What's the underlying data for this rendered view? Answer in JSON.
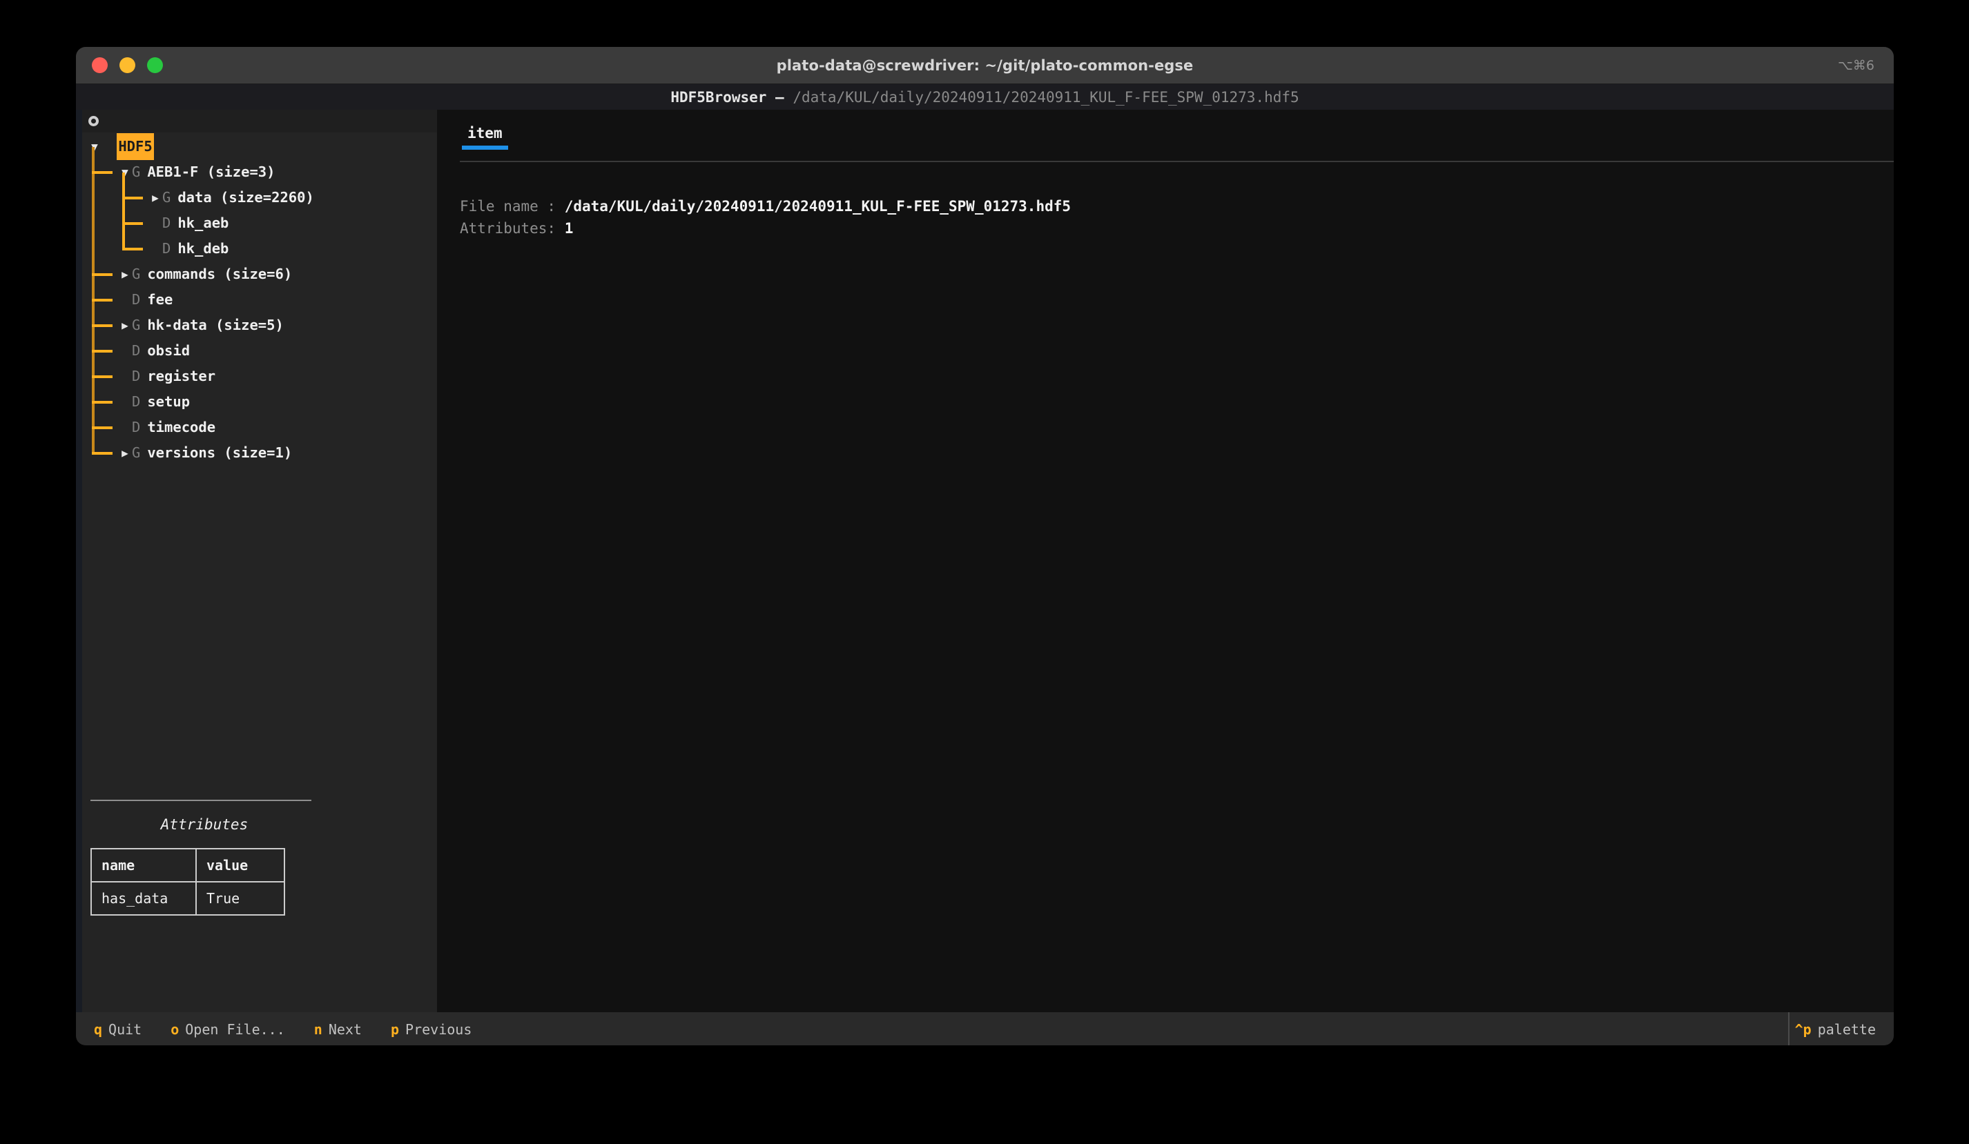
{
  "window": {
    "title": "plato-data@screwdriver: ~/git/plato-common-egse",
    "shortcut": "⌥⌘6",
    "traffic_lights": [
      "close",
      "minimize",
      "zoom"
    ]
  },
  "app_header": {
    "name": "HDF5Browser",
    "separator": "—",
    "path": "/data/KUL/daily/20240911/20240911_KUL_F-FEE_SPW_01273.hdf5"
  },
  "tree_pane": {
    "toolbar_icon": "loading-ring-icon",
    "nodes": [
      {
        "depth": 0,
        "caret": "▼",
        "kind": "",
        "label": "HDF5",
        "selected": true
      },
      {
        "depth": 1,
        "caret": "▼",
        "kind": "G",
        "label": "AEB1-F (size=3)",
        "selected": false
      },
      {
        "depth": 2,
        "caret": "▶",
        "kind": "G",
        "label": "data (size=2260)",
        "selected": false
      },
      {
        "depth": 2,
        "caret": "",
        "kind": "D",
        "label": "hk_aeb",
        "selected": false
      },
      {
        "depth": 2,
        "caret": "",
        "kind": "D",
        "label": "hk_deb",
        "selected": false
      },
      {
        "depth": 1,
        "caret": "▶",
        "kind": "G",
        "label": "commands (size=6)",
        "selected": false
      },
      {
        "depth": 1,
        "caret": "",
        "kind": "D",
        "label": "fee",
        "selected": false
      },
      {
        "depth": 1,
        "caret": "▶",
        "kind": "G",
        "label": "hk-data (size=5)",
        "selected": false
      },
      {
        "depth": 1,
        "caret": "",
        "kind": "D",
        "label": "obsid",
        "selected": false
      },
      {
        "depth": 1,
        "caret": "",
        "kind": "D",
        "label": "register",
        "selected": false
      },
      {
        "depth": 1,
        "caret": "",
        "kind": "D",
        "label": "setup",
        "selected": false
      },
      {
        "depth": 1,
        "caret": "",
        "kind": "D",
        "label": "timecode",
        "selected": false
      },
      {
        "depth": 1,
        "caret": "▶",
        "kind": "G",
        "label": "versions (size=1)",
        "selected": false
      }
    ]
  },
  "attributes_panel": {
    "title": "Attributes",
    "columns": [
      "name",
      "value"
    ],
    "rows": [
      [
        "has_data",
        "True"
      ]
    ]
  },
  "content": {
    "tabs": [
      {
        "label": "item",
        "active": true
      }
    ],
    "details": [
      {
        "key": "File name :",
        "value": "/data/KUL/daily/20240911/20240911_KUL_F-FEE_SPW_01273.hdf5"
      },
      {
        "key": "Attributes:",
        "value": "1"
      }
    ]
  },
  "footer": {
    "left_bindings": [
      {
        "key": "q",
        "desc": "Quit"
      },
      {
        "key": "o",
        "desc": "Open File..."
      },
      {
        "key": "n",
        "desc": "Next"
      },
      {
        "key": "p",
        "desc": "Previous"
      }
    ],
    "right_bindings": [
      {
        "key": "^p",
        "desc": "palette"
      }
    ]
  },
  "colors": {
    "accent_orange": "#ffb01f",
    "tab_underline_blue": "#1e90e8",
    "sidebar_bg": "#242424",
    "content_bg": "#111111",
    "titlebar_bg": "#3b3b3b"
  }
}
